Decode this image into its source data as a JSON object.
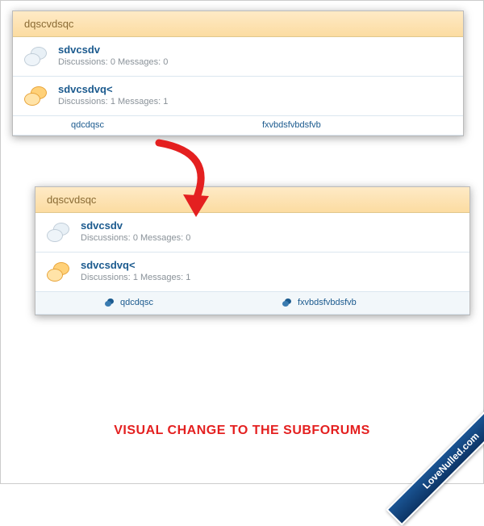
{
  "panel1": {
    "header": "dqscvdsqc",
    "forums": [
      {
        "title": "sdvcsdv",
        "disc_label": "Discussions:",
        "disc": "0",
        "msg_label": "Messages:",
        "msg": "0",
        "active": false
      },
      {
        "title": "sdvcsdvq<",
        "disc_label": "Discussions:",
        "disc": "1",
        "msg_label": "Messages:",
        "msg": "1",
        "active": true
      }
    ],
    "subs": [
      {
        "label": "qdcdqsc"
      },
      {
        "label": "fxvbdsfvbdsfvb"
      }
    ]
  },
  "panel2": {
    "header": "dqscvdsqc",
    "forums": [
      {
        "title": "sdvcsdv",
        "disc_label": "Discussions:",
        "disc": "0",
        "msg_label": "Messages:",
        "msg": "0",
        "active": false
      },
      {
        "title": "sdvcsdvq<",
        "disc_label": "Discussions:",
        "disc": "1",
        "msg_label": "Messages:",
        "msg": "1",
        "active": true
      }
    ],
    "subs": [
      {
        "label": "qdcdqsc"
      },
      {
        "label": "fxvbdsfvbdsfvb"
      }
    ]
  },
  "caption": "VISUAL CHANGE TO THE SUBFORUMS",
  "ribbon": "LoveNulled.com"
}
